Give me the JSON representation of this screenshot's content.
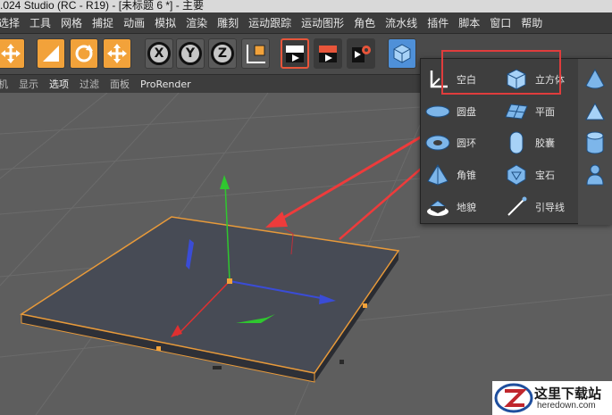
{
  "window": {
    "title": ".024 Studio (RC - R19) - [未标题 6 *] - 主要"
  },
  "menubar": {
    "items": [
      "选择",
      "工具",
      "网格",
      "捕捉",
      "动画",
      "模拟",
      "渲染",
      "雕刻",
      "运动跟踪",
      "运动图形",
      "角色",
      "流水线",
      "插件",
      "脚本",
      "窗口",
      "帮助"
    ]
  },
  "viewport_menu": {
    "items": [
      "机",
      "显示",
      "选项",
      "过滤",
      "面板",
      "ProRender"
    ]
  },
  "toolbar": {
    "axis_x": "X",
    "axis_y": "Y",
    "axis_z": "Z",
    "icons": [
      "move-icon",
      "scale-icon",
      "rotate-icon",
      "transform-icon",
      "lock-x-icon",
      "lock-y-icon",
      "lock-z-icon",
      "coordinate-system-icon",
      "render-view-icon",
      "render-active-icon",
      "render-settings-icon",
      "cube-icon"
    ]
  },
  "object_menu": {
    "col1": [
      {
        "icon": "null-object-icon",
        "label": "空白"
      },
      {
        "icon": "disc-icon",
        "label": "圆盘"
      },
      {
        "icon": "torus-icon",
        "label": "圆环"
      },
      {
        "icon": "pyramid-icon",
        "label": "角锥"
      },
      {
        "icon": "floor-icon",
        "label": "地貌"
      }
    ],
    "col2": [
      {
        "icon": "cube-icon",
        "label": "立方体"
      },
      {
        "icon": "plane-icon",
        "label": "平面"
      },
      {
        "icon": "capsule-icon",
        "label": "胶囊"
      },
      {
        "icon": "platonic-icon",
        "label": "宝石"
      },
      {
        "icon": "guide-line-icon",
        "label": "引导线"
      }
    ],
    "col3": [
      "cone-icon",
      "pyramid-small-icon",
      "cylinder-icon",
      "figure-icon"
    ]
  },
  "watermark": {
    "title": "这里下载站",
    "domain": "heredown.com"
  },
  "colors": {
    "highlight": "#e03c3c",
    "selection": "#f2a23a",
    "accent": "#4f90d8"
  }
}
